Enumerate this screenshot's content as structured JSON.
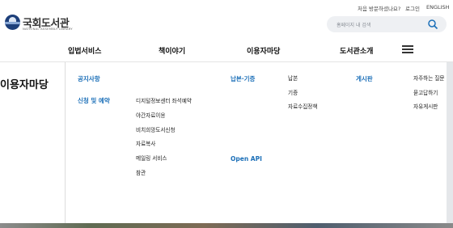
{
  "utility": {
    "first_visit": "처음 방문하셨나요?",
    "login": "로그인",
    "english": "ENGLISH"
  },
  "logo": {
    "name": "국회도서관",
    "subtitle": "NATIONAL ASSEMBLY LIBRARY"
  },
  "search": {
    "placeholder": "홈페이지 내 검색"
  },
  "nav": {
    "items": [
      "입법서비스",
      "책이야기",
      "이용자마당",
      "도서관소개"
    ]
  },
  "panel": {
    "title": "이용자마당",
    "col1": {
      "notice": "공지사항",
      "apply": "신청 및 예약",
      "apply_items": [
        "디지털정보센터 좌석예약",
        "야간자료이용",
        "비치희망도서신청",
        "자료복사",
        "메일링 서비스",
        "참관"
      ]
    },
    "col2": {
      "deposit": "납본·기증",
      "open_api": "Open API"
    },
    "col3": {
      "items": [
        "납본",
        "기증",
        "자료수집정책"
      ]
    },
    "col4": {
      "board": "게시판"
    },
    "col5": {
      "items": [
        "자주하는 질문",
        "묻고답하기",
        "자유게시판"
      ]
    }
  },
  "colors": {
    "accent": "#1b6fb8",
    "logo": "#1d3f7a"
  }
}
